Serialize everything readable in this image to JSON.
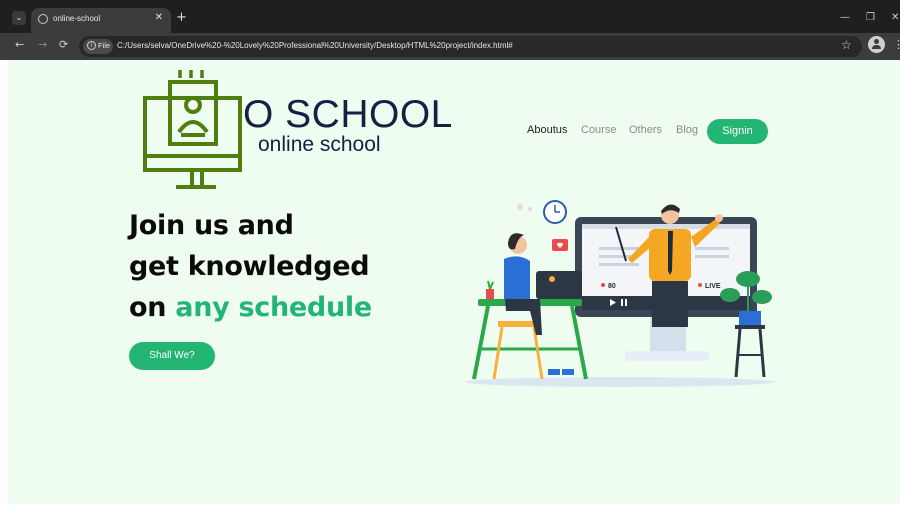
{
  "browser": {
    "tab_title": "online-school",
    "file_label": "File",
    "url": "C:/Users/selva/OneDrive%20-%20Lovely%20Professional%20University/Desktop/HTML%20project/index.html#",
    "new_tab": "+",
    "close_tab": "✕",
    "menu_glyph": "⌄",
    "back_glyph": "←",
    "forward_glyph": "→",
    "reload_glyph": "⟳",
    "star_glyph": "☆",
    "kebab_glyph": "⋮",
    "minimize_glyph": "—",
    "restore_glyph": "❐",
    "close_glyph": "✕"
  },
  "site": {
    "brand": {
      "name": "O SCHOOL",
      "tagline": "online school",
      "logo_icon": "monitor-with-user-icon",
      "logo_color": "#4f7e0e",
      "text_color": "#132143"
    },
    "nav": {
      "items": [
        {
          "label": "Aboutus",
          "active": true
        },
        {
          "label": "Course",
          "active": false
        },
        {
          "label": "Others",
          "active": false
        },
        {
          "label": "Blog",
          "active": false
        }
      ],
      "signin_label": "Signin"
    },
    "hero": {
      "line1": "Join us and",
      "line2": "get knowledged",
      "line3_prefix": "on ",
      "line3_accent": "any schedule",
      "cta_label": "Shall We?"
    },
    "illustration": {
      "viewer_count": "80",
      "live_label": "LIVE"
    },
    "colors": {
      "accent": "#22b573",
      "background": "#effdf0",
      "heading": "#0b0b0b"
    }
  }
}
